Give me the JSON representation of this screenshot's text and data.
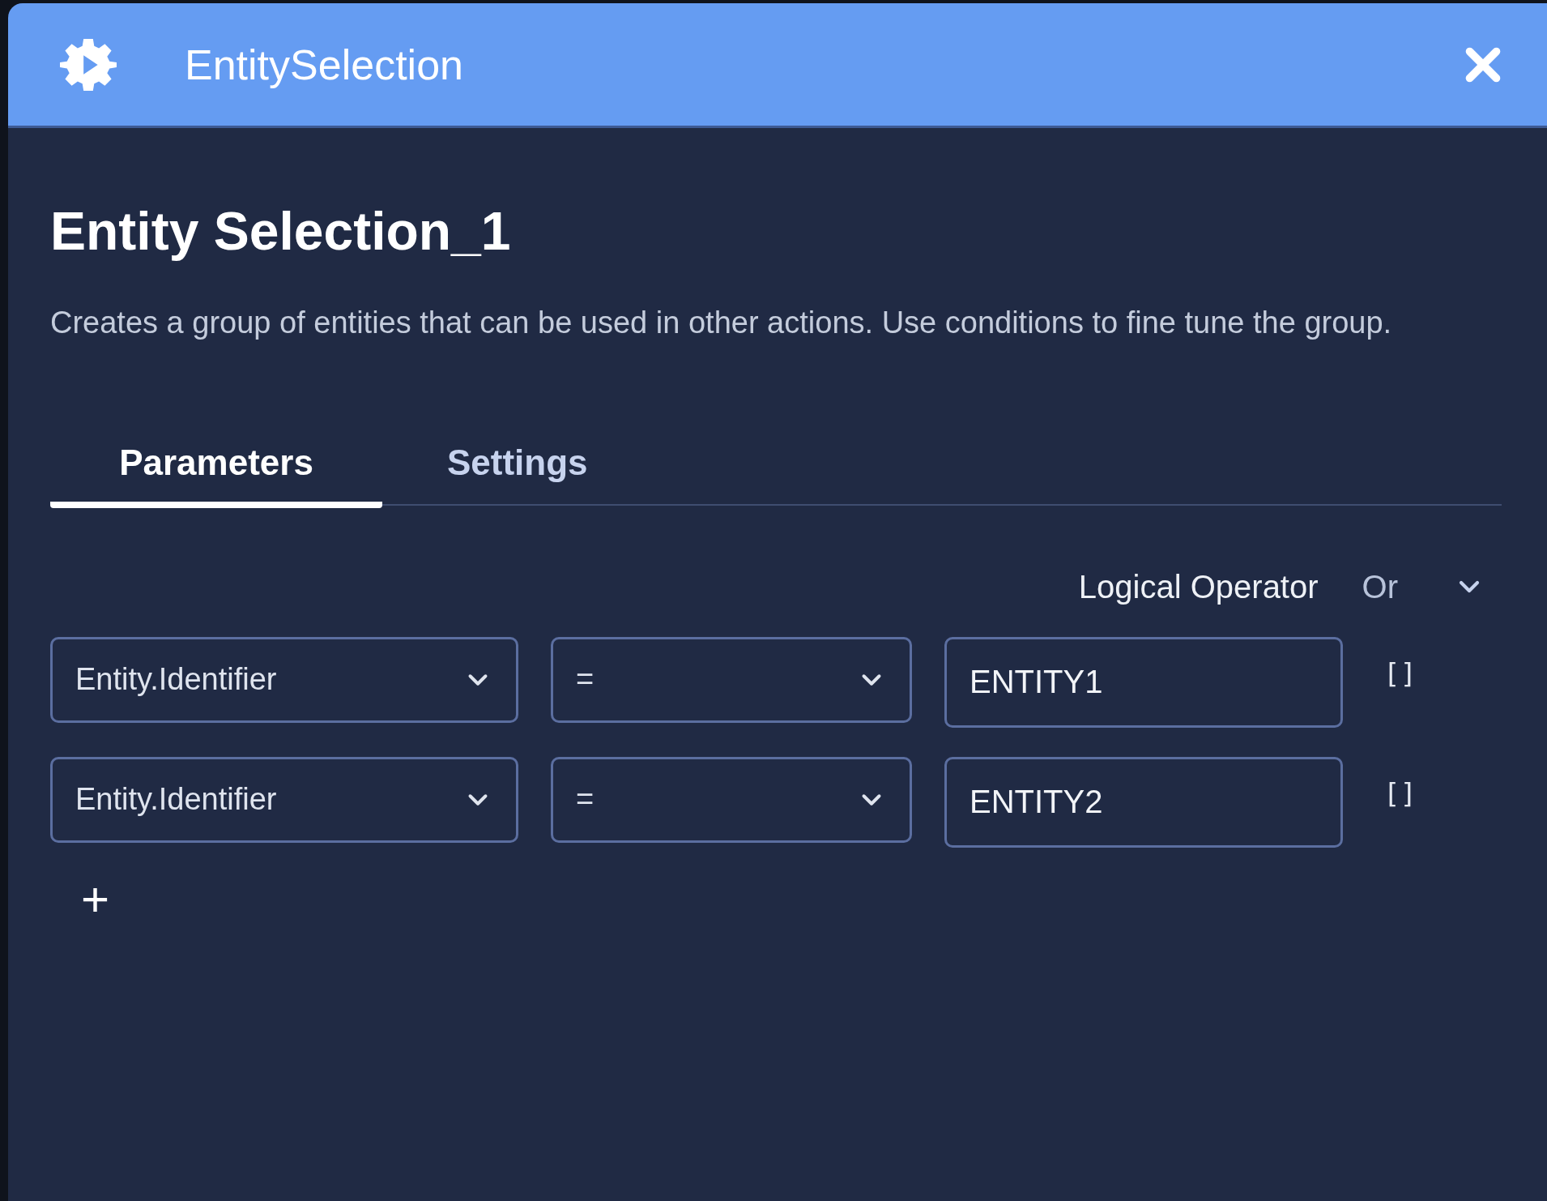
{
  "window": {
    "title": "EntitySelection"
  },
  "heading": "Entity Selection_1",
  "description": "Creates a group of entities that can be used in other actions. Use conditions to fine tune the group.",
  "tabs": [
    {
      "label": "Parameters",
      "selected": true
    },
    {
      "label": "Settings",
      "selected": false
    }
  ],
  "logical_operator": {
    "label": "Logical Operator",
    "value": "Or"
  },
  "conditions": [
    {
      "field": "Entity.Identifier",
      "operator": "=",
      "value": "ENTITY1",
      "list_toggle": "[]"
    },
    {
      "field": "Entity.Identifier",
      "operator": "=",
      "value": "ENTITY2",
      "list_toggle": "[]"
    }
  ],
  "add_button": "+"
}
